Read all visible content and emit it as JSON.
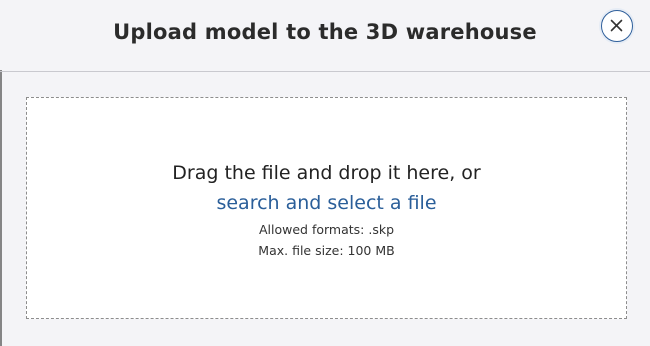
{
  "dialog": {
    "title": "Upload model to the 3D warehouse",
    "close_icon": "close-icon"
  },
  "dropzone": {
    "drag_text": "Drag the file and drop it here, or",
    "select_link": "search and select a file",
    "allowed_formats": "Allowed formats: .skp",
    "max_file_size": "Max. file size: 100 MB"
  },
  "colors": {
    "link": "#2a5e99",
    "close_border": "#2f5f9b",
    "background": "#f4f4f7",
    "dropzone_border": "#8d8d8d"
  }
}
